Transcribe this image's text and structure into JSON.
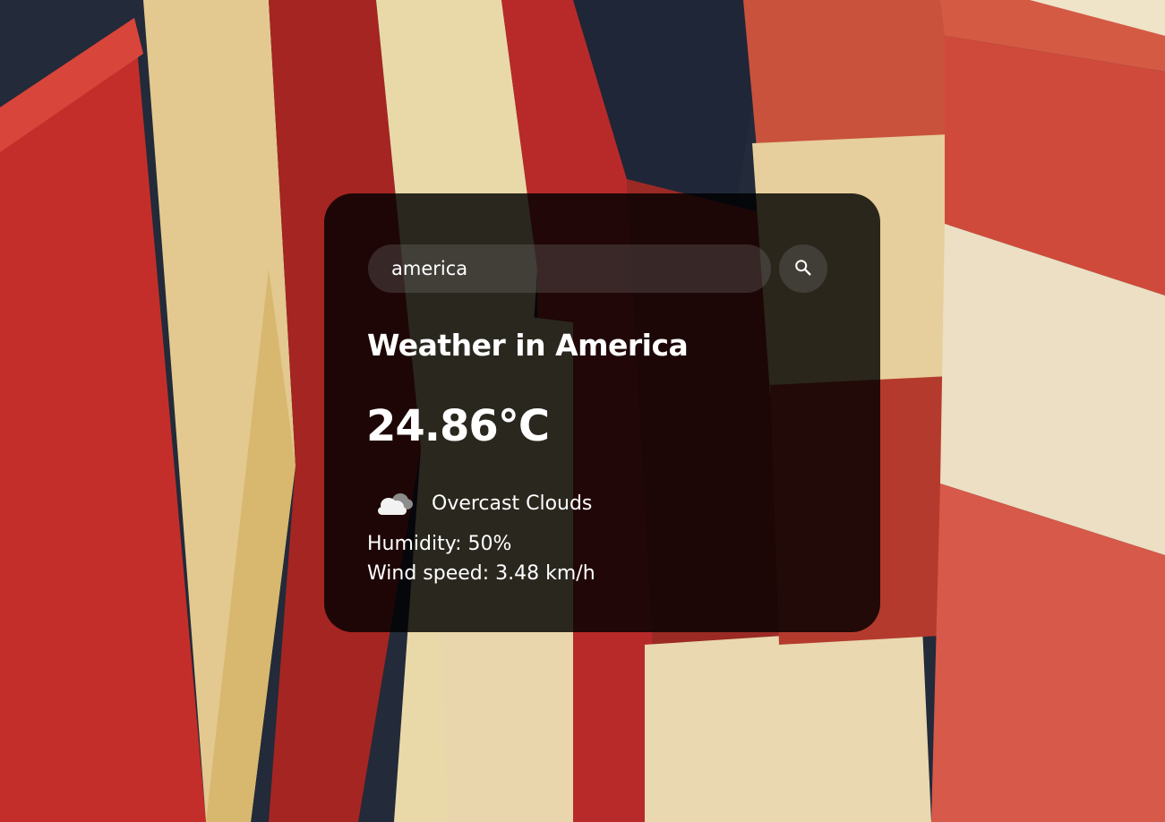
{
  "background": {
    "subject": "american-flags-photo",
    "colors": [
      "#c4302b",
      "#e8d6b4",
      "#222a3a",
      "#d85c48"
    ]
  },
  "search": {
    "value": "america",
    "placeholder": "Search",
    "button_icon": "search-icon"
  },
  "weather": {
    "city": "Weather in America",
    "temperature": "24.86°C",
    "icon": "cloud-icon",
    "description": "Overcast Clouds",
    "humidity": "Humidity: 50%",
    "wind": "Wind speed: 3.48 km/h"
  },
  "theme": {
    "card_background": "rgba(0,0,0,0.82)",
    "text_color": "#ffffff",
    "input_background": "rgba(124,124,124,0.28)"
  }
}
